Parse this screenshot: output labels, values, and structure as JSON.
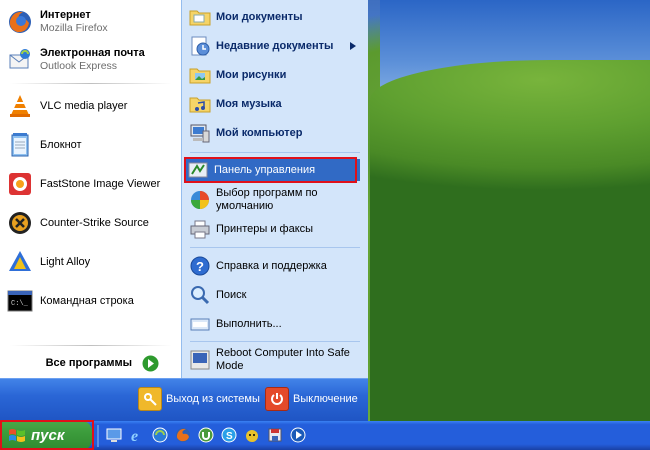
{
  "start_menu": {
    "pinned": [
      {
        "title": "Интернет",
        "subtitle": "Mozilla Firefox",
        "icon": "firefox-icon"
      },
      {
        "title": "Электронная почта",
        "subtitle": "Outlook Express",
        "icon": "outlook-express-icon"
      }
    ],
    "recent": [
      {
        "title": "VLC media player",
        "icon": "vlc-icon"
      },
      {
        "title": "Блокнот",
        "icon": "notepad-icon"
      },
      {
        "title": "FastStone Image Viewer",
        "icon": "faststone-icon"
      },
      {
        "title": "Counter-Strike Source",
        "icon": "counter-strike-icon"
      },
      {
        "title": "Light Alloy",
        "icon": "light-alloy-icon"
      },
      {
        "title": "Командная строка",
        "icon": "command-prompt-icon"
      }
    ],
    "all_programs_label": "Все программы",
    "right": {
      "my_documents": "Мои документы",
      "recent_documents": "Недавние документы",
      "my_pictures": "Мои рисунки",
      "my_music": "Моя музыка",
      "my_computer": "Мой компьютер",
      "control_panel": "Панель управления",
      "default_programs": "Выбор программ по умолчанию",
      "printers": "Принтеры и факсы",
      "help": "Справка и поддержка",
      "search": "Поиск",
      "run": "Выполнить...",
      "reboot": "Reboot Computer Into Safe Mode"
    },
    "footer": {
      "logoff": "Выход из системы",
      "shutdown": "Выключение"
    }
  },
  "taskbar": {
    "start_label": "пуск",
    "quick_launch": [
      "desktop-icon",
      "ie-icon",
      "outlook-icon",
      "firefox-icon",
      "utorrent-icon",
      "skype-icon",
      "app-icon",
      "save-icon",
      "media-player-icon"
    ]
  },
  "colors": {
    "highlight": "#316ac5",
    "annotation_red": "#e0101a",
    "taskbar_blue": "#245edb",
    "start_green": "#3c9c3c"
  }
}
